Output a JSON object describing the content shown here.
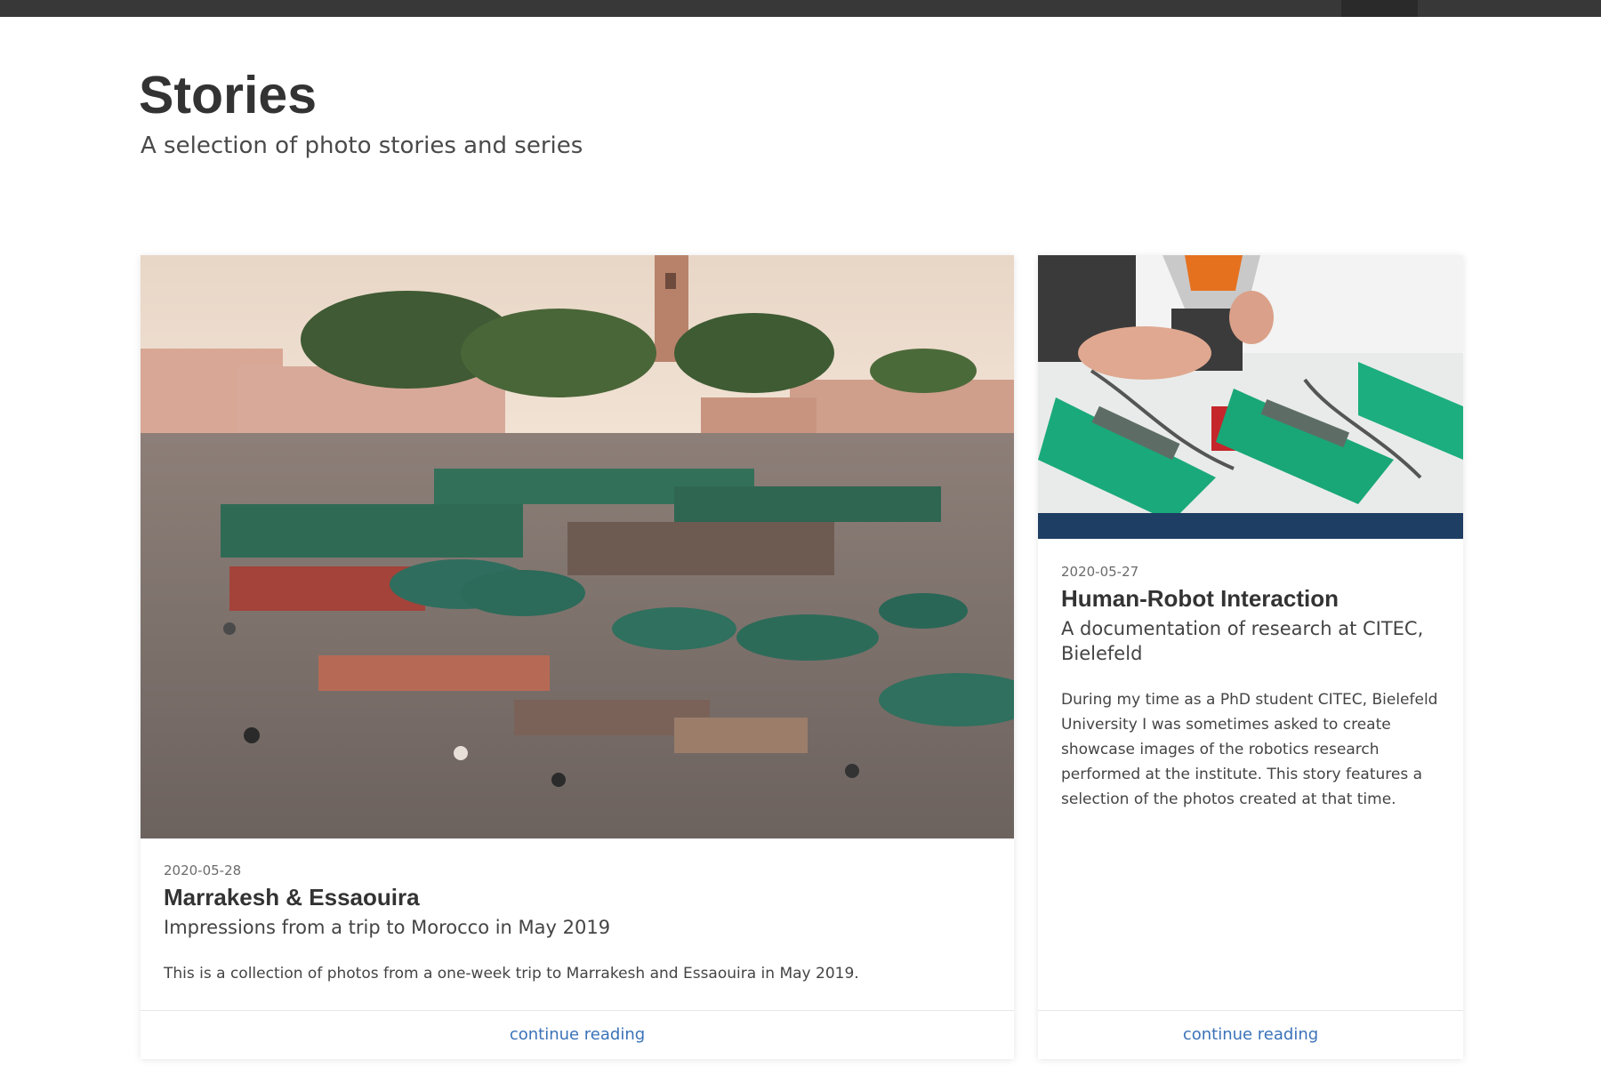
{
  "header": {
    "title": "Stories",
    "subtitle": "A selection of photo stories and series"
  },
  "colors": {
    "topbar": "#383838",
    "link": "#3a72b8",
    "text": "#333333"
  },
  "stories": [
    {
      "image_icon": "marrakesh-market-photo",
      "date": "2020-05-28",
      "title": "Marrakesh & Essaouira",
      "subtitle": "Impressions from a trip to Morocco in May 2019",
      "text": "This is a collection of photos from a one-week trip to Marrakesh and Essaouira in May 2019.",
      "link_label": "continue reading"
    },
    {
      "image_icon": "robot-gripper-photo",
      "date": "2020-05-27",
      "title": "Human-Robot Interaction",
      "subtitle": "A documentation of research at CITEC, Bielefeld",
      "text": "During my time as a PhD student CITEC, Bielefeld University I was sometimes asked to create showcase images of the robotics research performed at the institute. This story features a selection of the photos created at that time.",
      "link_label": "continue reading"
    }
  ]
}
